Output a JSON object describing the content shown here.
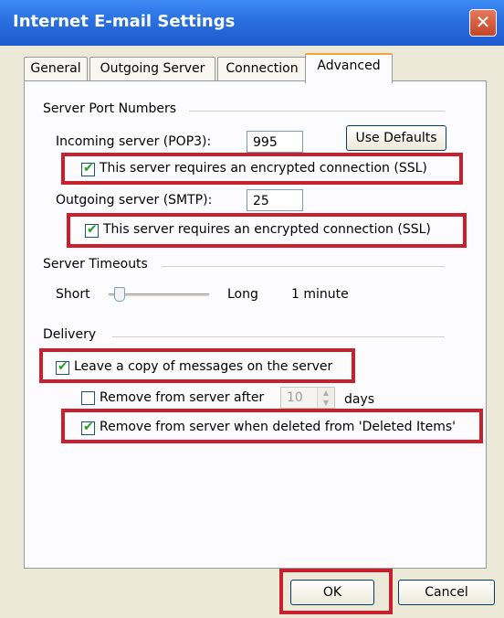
{
  "window": {
    "title": "Internet E-mail Settings",
    "close_icon": "close-icon"
  },
  "tabs": [
    {
      "label": "General"
    },
    {
      "label": "Outgoing Server"
    },
    {
      "label": "Connection"
    },
    {
      "label": "Advanced"
    }
  ],
  "server_ports": {
    "section_label": "Server Port Numbers",
    "incoming_label": "Incoming server (POP3):",
    "incoming_value": "995",
    "use_defaults": "Use Defaults",
    "incoming_ssl_label": "This server requires an encrypted connection (SSL)",
    "incoming_ssl_checked": true,
    "outgoing_label": "Outgoing server (SMTP):",
    "outgoing_value": "25",
    "outgoing_ssl_label": "This server requires an encrypted connection (SSL)",
    "outgoing_ssl_checked": true
  },
  "timeouts": {
    "section_label": "Server Timeouts",
    "short_label": "Short",
    "long_label": "Long",
    "value_text": "1 minute"
  },
  "delivery": {
    "section_label": "Delivery",
    "leave_copy_label": "Leave a copy of messages on the server",
    "leave_copy_checked": true,
    "remove_after_label": "Remove from server after",
    "remove_after_checked": false,
    "remove_after_days": "10",
    "days_label": "days",
    "remove_deleted_label": "Remove from server when deleted from 'Deleted Items'",
    "remove_deleted_checked": true
  },
  "footer": {
    "ok_label": "OK",
    "cancel_label": "Cancel"
  },
  "colors": {
    "highlight": "#c8202c",
    "titlebar": "#2a6fe0",
    "dialog_bg": "#ece9d8"
  }
}
